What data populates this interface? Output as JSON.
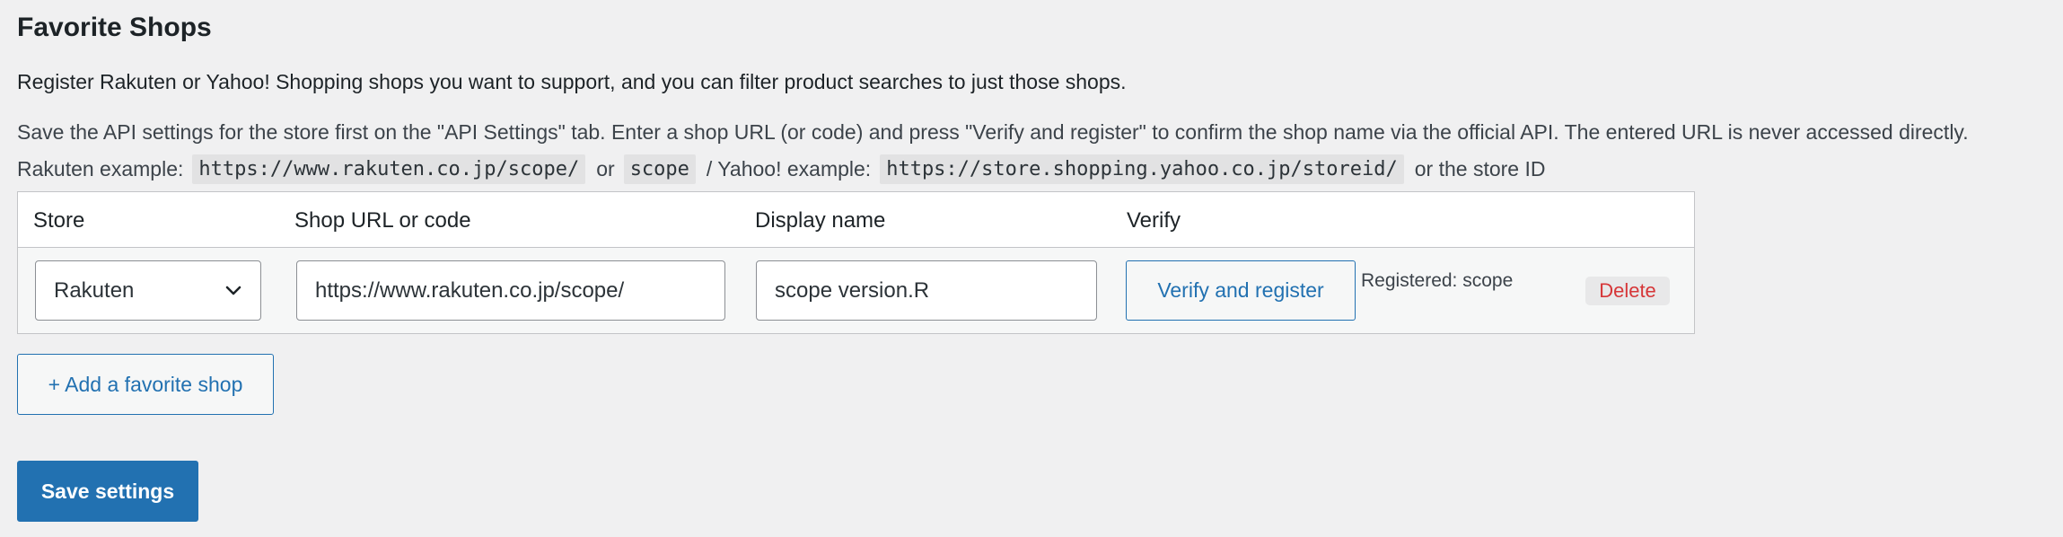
{
  "section": {
    "title": "Favorite Shops",
    "description": "Register Rakuten or Yahoo! Shopping shops you want to support, and you can filter product searches to just those shops.",
    "instructions": "Save the API settings for the store first on the \"API Settings\" tab. Enter a shop URL (or code) and press \"Verify and register\" to confirm the shop name via the official API. The entered URL is never accessed directly.",
    "examples": {
      "rakuten_prefix": "Rakuten example:",
      "rakuten_url": "https://www.rakuten.co.jp/scope/",
      "or_label": "or",
      "rakuten_code": "scope",
      "yahoo_prefix": "/ Yahoo! example:",
      "yahoo_url": "https://store.shopping.yahoo.co.jp/storeid/",
      "yahoo_suffix": "or the store ID"
    }
  },
  "table": {
    "columns": [
      "Store",
      "Shop URL or code",
      "Display name",
      "Verify"
    ],
    "rows": [
      {
        "store": "Rakuten",
        "shop_url": "https://www.rakuten.co.jp/scope/",
        "display_name": "scope version.R",
        "verify_label": "Verify and register",
        "status": "Registered: scope",
        "delete_label": "Delete"
      }
    ]
  },
  "actions": {
    "add_label": "+ Add a favorite shop",
    "save_label": "Save settings"
  },
  "colors": {
    "accent": "#2271b1",
    "danger": "#d63638",
    "background": "#f0f0f1"
  }
}
